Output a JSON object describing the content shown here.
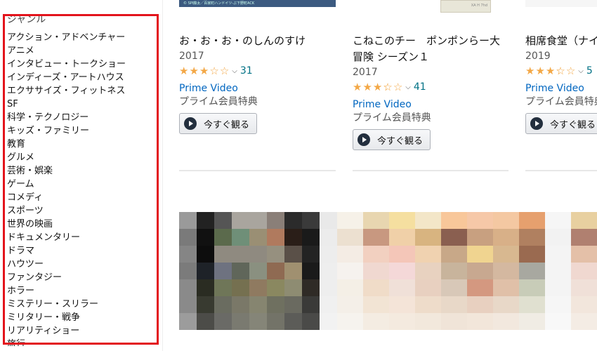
{
  "sidebar": {
    "heading": "ジャンル",
    "genres": [
      "アクション・アドベンチャー",
      "アニメ",
      "インタビュー・トークショー",
      "インディーズ・アートハウス",
      "エクササイズ・フィットネス",
      "SF",
      "科学・テクノロジー",
      "キッズ・ファミリー",
      "教育",
      "グルメ",
      "芸術・娯楽",
      "ゲーム",
      "コメディ",
      "スポーツ",
      "世界の映画",
      "ドキュメンタリー",
      "ドラマ",
      "ハウツー",
      "ファンタジー",
      "ホラー",
      "ミステリー・スリラー",
      "ミリタリー・戦争",
      "リアリティショー",
      "旅行"
    ],
    "highlight_color": "#e3141c"
  },
  "thumbs": {
    "thumb1_caption": "© SPI藤太／百家町ハンドイツ-ぶ下野町ACK",
    "thumb2_caption": "XA H 7hd"
  },
  "cards": [
    {
      "title": "お・お・お・のしんのすけ",
      "year": "2017",
      "stars": [
        1,
        1,
        1,
        0,
        0
      ],
      "rating_count": "31",
      "service": "Prime Video",
      "benefit": "プライム会員特典",
      "button": "今すぐ観る"
    },
    {
      "title": "こねこのチー　ポンポンらー大冒険 シーズン１",
      "year": "2017",
      "stars": [
        1,
        1,
        1,
        0.5,
        0
      ],
      "rating_count": "41",
      "service": "Prime Video",
      "benefit": "プライム会員特典",
      "button": "今すぐ観る"
    },
    {
      "title": "相席食堂（ナイ",
      "year": "2019",
      "stars": [
        1,
        1,
        1,
        0.5,
        0
      ],
      "rating_count": "5",
      "service": "Prime Video",
      "benefit": "プライム会員特典",
      "button": "今すぐ観る"
    }
  ],
  "colors": {
    "star": "#f3a847",
    "link": "#0066c0",
    "count": "#007185"
  },
  "mosaics": [
    {
      "cols": 9,
      "rows": 7,
      "colors": [
        "#9a9a9a",
        "#222222",
        "#555555",
        "#a9a59e",
        "#a9a59e",
        "#8a7f78",
        "#2b2b2b",
        "#3a3a3a",
        "#e9e9e9",
        "#7a7a7a",
        "#111111",
        "#5b6a4c",
        "#6f8f78",
        "#9a8f74",
        "#b07a5e",
        "#2a1e18",
        "#1a1a1a",
        "#ececec",
        "#858585",
        "#0d0d0d",
        "#8f8a80",
        "#8f8a80",
        "#8f8a80",
        "#96907f",
        "#5a5048",
        "#232323",
        "#ededed",
        "#7b7b7b",
        "#1e2228",
        "#6e7280",
        "#60665a",
        "#8a9080",
        "#8f6a52",
        "#a09070",
        "#1a1a1a",
        "#eeeeee",
        "#8a8a8a",
        "#2a2c22",
        "#6f7658",
        "#757050",
        "#8f7a60",
        "#8a8860",
        "#8e8c72",
        "#2f2b26",
        "#eeeeee",
        "#8a8a8a",
        "#383a30",
        "#6a6c60",
        "#7a7868",
        "#868570",
        "#6f7060",
        "#6a6a60",
        "#3a3a38",
        "#f0f0f0",
        "#9c9c9c",
        "#4c4c48",
        "#6a6a66",
        "#7a7a70",
        "#858578",
        "#737368",
        "#5c5c58",
        "#4a4a48",
        "#f2f2f2"
      ]
    },
    {
      "cols": 10,
      "rows": 7,
      "colors": [
        "#f6f1e8",
        "#e8d6b0",
        "#f5dfa0",
        "#f3e6c8",
        "#f8c79a",
        "#f6c8a8",
        "#f4c8a2",
        "#e6a06e",
        "#f6f6f6",
        "#e8d0a0",
        "#ece0d0",
        "#c89880",
        "#f0d0a8",
        "#d8b480",
        "#8a5f50",
        "#c8a080",
        "#d8b088",
        "#b08060",
        "#f2f2f2",
        "#b08070",
        "#f4ece4",
        "#f2d0c0",
        "#f4c6b8",
        "#f0d2b0",
        "#c8a888",
        "#f0d490",
        "#d8b890",
        "#9a6a50",
        "#f4f4f4",
        "#e4c0a8",
        "#f6f2ee",
        "#f0d8d0",
        "#f4d8d8",
        "#e8d2c0",
        "#c8b49c",
        "#c8a890",
        "#d4b8a0",
        "#a8a8a0",
        "#f4f4f4",
        "#f0d8d0",
        "#f4efe6",
        "#f0dcc8",
        "#f0e0d8",
        "#e8d0c0",
        "#d8c8b8",
        "#d49880",
        "#e0c0a8",
        "#c8ccb8",
        "#f4f4f4",
        "#f0e0d8",
        "#f4efe8",
        "#f2e4d4",
        "#f4e4d8",
        "#eedcca",
        "#e8d8c8",
        "#e8d0c0",
        "#e8d8c8",
        "#e0e0d0",
        "#f6f6f6",
        "#f2e6dc",
        "#f6f3ee",
        "#f4ece2",
        "#f4eadf",
        "#f2e8dc",
        "#f0e4d8",
        "#f2e6da",
        "#f2e8de",
        "#f0ece4",
        "#f8f8f8",
        "#f4ece4"
      ]
    }
  ]
}
